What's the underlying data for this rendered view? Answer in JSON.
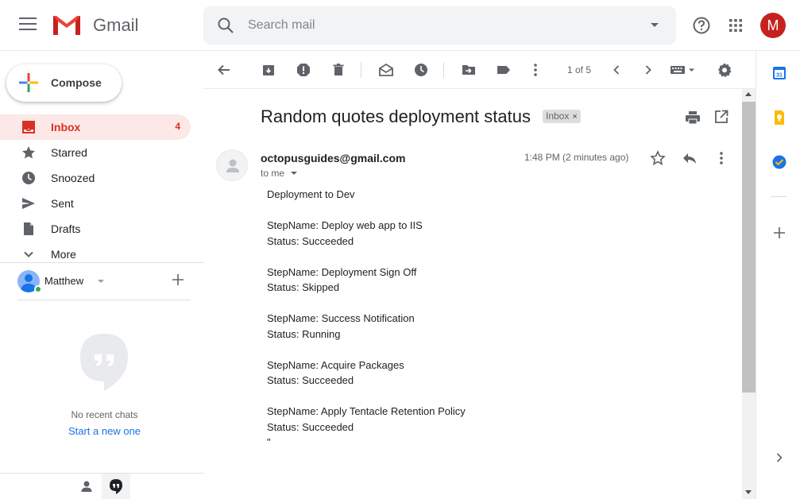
{
  "header": {
    "app_name": "Gmail",
    "search_placeholder": "Search mail",
    "account_initial": "M"
  },
  "compose": {
    "label": "Compose"
  },
  "nav": [
    {
      "label": "Inbox",
      "count": "4",
      "active": true,
      "icon": "inbox-icon"
    },
    {
      "label": "Starred",
      "count": "",
      "icon": "star-icon"
    },
    {
      "label": "Snoozed",
      "count": "",
      "icon": "clock-icon"
    },
    {
      "label": "Sent",
      "count": "",
      "icon": "send-icon"
    },
    {
      "label": "Drafts",
      "count": "",
      "icon": "draft-icon"
    },
    {
      "label": "More",
      "count": "",
      "icon": "chevron-down-icon"
    }
  ],
  "hangouts": {
    "user_name": "Matthew",
    "empty_title": "No recent chats",
    "start_link": "Start a new one"
  },
  "toolbar": {
    "page_count": "1 of 5"
  },
  "email": {
    "subject": "Random quotes deployment status",
    "label": "Inbox",
    "label_remove": "×",
    "sender": "octopusguides@gmail.com",
    "recipient": "to me",
    "time": "1:48 PM (2 minutes ago)",
    "body": "Deployment to Dev\n\nStepName: Deploy web app to IIS\nStatus: Succeeded\n\nStepName: Deployment Sign Off\nStatus: Skipped\n\nStepName: Success Notification\nStatus: Running\n\nStepName: Acquire Packages\nStatus: Succeeded\n\nStepName: Apply Tentacle Retention Policy\nStatus: Succeeded\n\""
  },
  "colors": {
    "accent": "#d93025",
    "active_bg": "#fce8e6",
    "link": "#1a73e8",
    "avatar": "#c5221f"
  }
}
